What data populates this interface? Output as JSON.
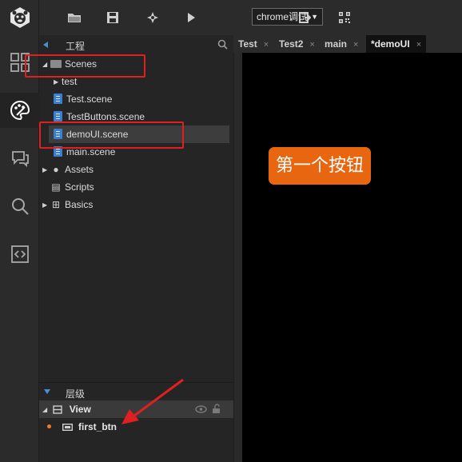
{
  "activity_bar": {
    "items": [
      {
        "name": "logo",
        "icon": "monkey-logo-icon"
      },
      {
        "name": "layout",
        "icon": "grid-layout-icon"
      },
      {
        "name": "design",
        "icon": "palette-icon"
      },
      {
        "name": "chat",
        "icon": "chat-icon"
      },
      {
        "name": "search",
        "icon": "search-icon"
      },
      {
        "name": "code",
        "icon": "code-bracket-icon"
      }
    ]
  },
  "toolbar": {
    "buttons": [
      "folder-icon",
      "save-icon",
      "publish-icon",
      "play-icon",
      "exit-icon",
      "qr-code-icon"
    ],
    "run_target": "chrome调试"
  },
  "project_panel": {
    "title": "工程",
    "tree": {
      "scenes": "Scenes",
      "test": "test",
      "test_scene": "Test.scene",
      "testbuttons_scene": "TestButtons.scene",
      "demoui_scene": "demoUI.scene",
      "main_scene": "main.scene",
      "assets": "Assets",
      "scripts": "Scripts",
      "basics": "Basics"
    }
  },
  "hierarchy_panel": {
    "title": "层级",
    "root": "View",
    "child": "first_btn"
  },
  "editor_tabs": [
    {
      "label": "Test",
      "close": "×"
    },
    {
      "label": "Test2",
      "close": "×"
    },
    {
      "label": "main",
      "close": "×"
    },
    {
      "label": "*demoUI",
      "close": "×"
    }
  ],
  "canvas": {
    "button_text": "第一个按钮",
    "button_color": "#e8660f",
    "background": "#000000"
  },
  "colors": {
    "accent": "#4a8fd6",
    "annotation": "#e02020"
  }
}
